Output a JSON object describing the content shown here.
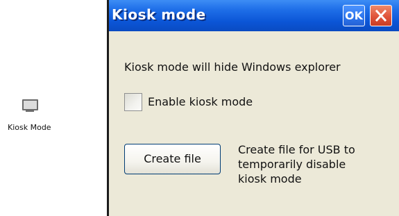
{
  "desktop": {
    "icon": "monitor-icon",
    "label": "Kiosk Mode"
  },
  "window": {
    "title": "Kiosk mode",
    "ok_label": "OK",
    "close_icon": "close-icon",
    "description": "Kiosk mode will hide Windows explorer",
    "checkbox": {
      "label": "Enable kiosk mode",
      "checked": false
    },
    "create_button_label": "Create file",
    "create_description_lines": [
      "Create file for USB to",
      "temporarily disable",
      "kiosk mode"
    ]
  },
  "colors": {
    "titlebar": "#0b55d6",
    "window_bg": "#ece9d8",
    "close_button": "#e0543a"
  }
}
